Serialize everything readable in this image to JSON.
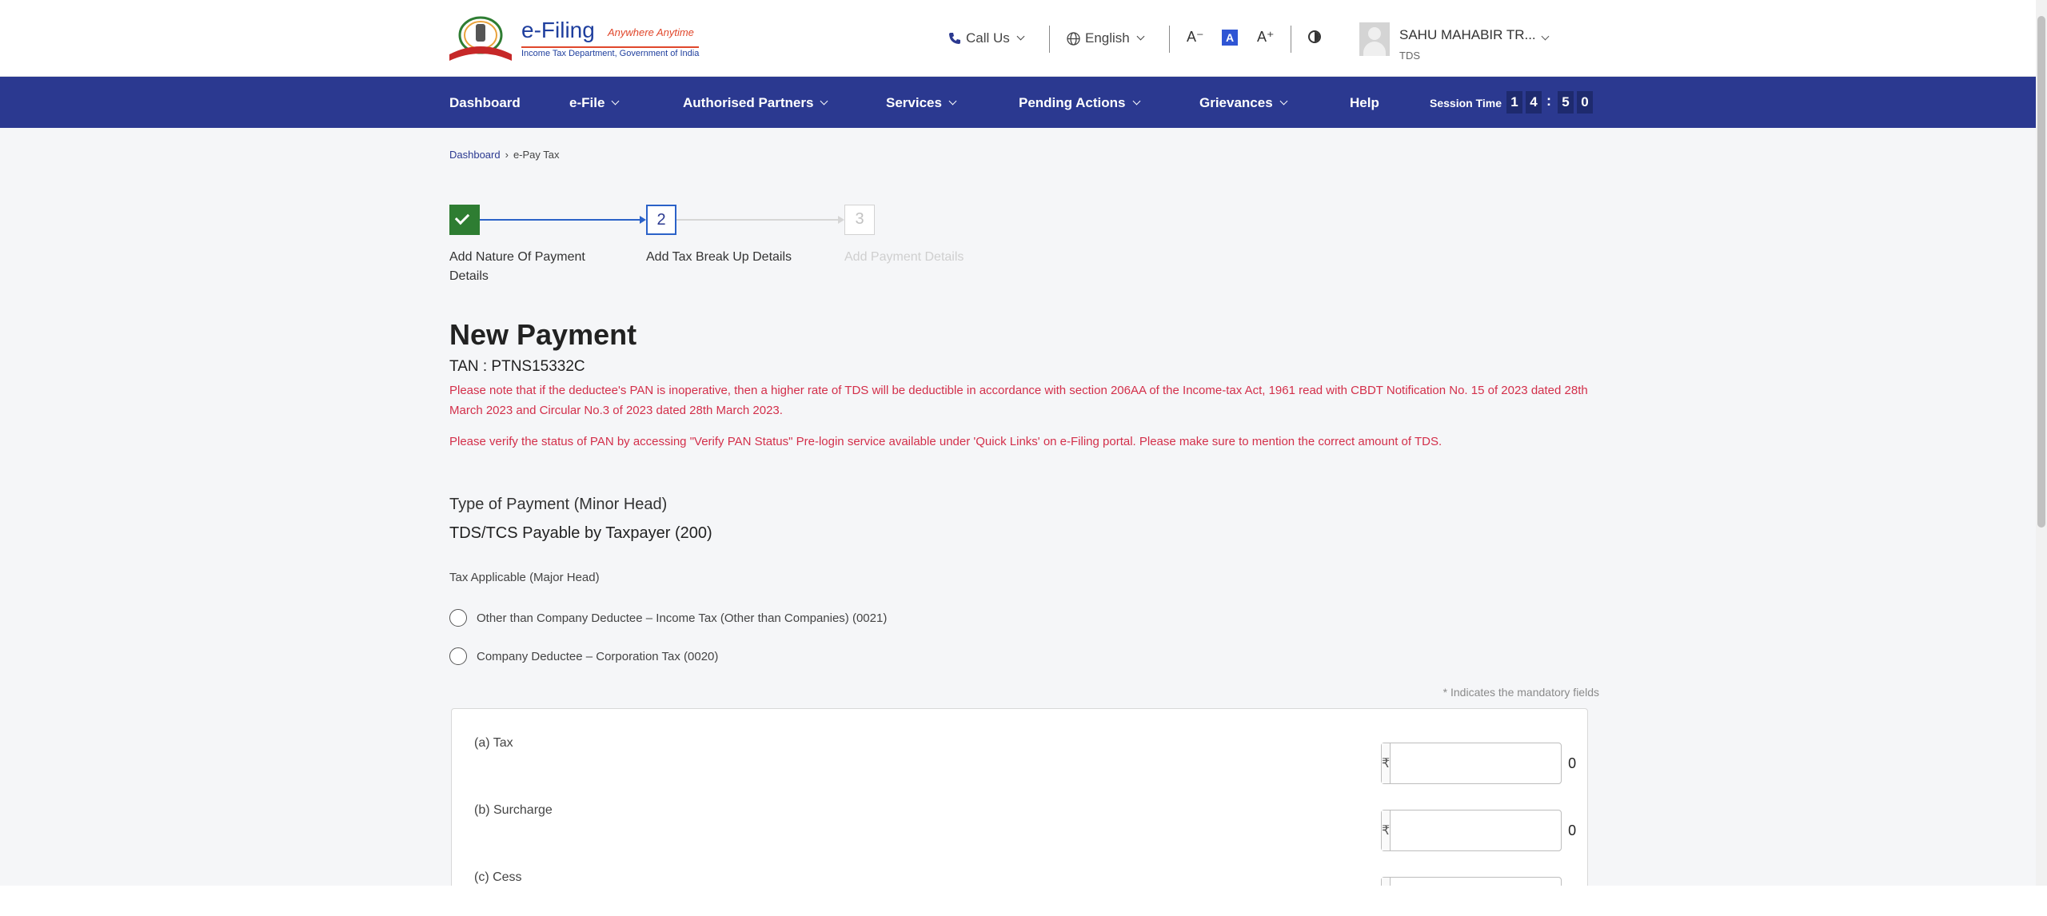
{
  "header": {
    "logo_title": "e-Filing",
    "logo_tagline": "Anywhere Anytime",
    "logo_subtitle": "Income Tax Department, Government of India",
    "call_us": "Call Us",
    "language": "English",
    "font_decrease": "A⁻",
    "font_normal": "A",
    "font_increase": "A⁺",
    "user_name": "SAHU MAHABIR TR...",
    "user_role": "TDS"
  },
  "nav": {
    "items": [
      "Dashboard",
      "e-File",
      "Authorised Partners",
      "Services",
      "Pending Actions",
      "Grievances",
      "Help"
    ],
    "session_label": "Session Time",
    "session_digits": [
      "1",
      "4",
      "5",
      "0"
    ],
    "session_colon": ":"
  },
  "breadcrumb": {
    "home": "Dashboard",
    "separator": "›",
    "current": "e-Pay Tax"
  },
  "stepper": {
    "steps": [
      {
        "number": "1",
        "label": "Add Nature Of Payment Details",
        "state": "done"
      },
      {
        "number": "2",
        "label": "Add Tax Break Up Details",
        "state": "active"
      },
      {
        "number": "3",
        "label": "Add Payment Details",
        "state": "pending"
      }
    ]
  },
  "main": {
    "title": "New Payment",
    "tan": "TAN : PTNS15332C",
    "warning_1": "Please note that if the deductee's PAN is inoperative, then a higher rate of TDS will be deductible in accordance with section 206AA of the Income-tax Act, 1961 read with CBDT Notification No. 15 of 2023 dated 28th March 2023 and Circular No.3 of 2023 dated 28th March 2023.",
    "warning_2": "Please verify the status of PAN by accessing \"Verify PAN Status\" Pre-login service available under 'Quick Links' on e-Filing portal. Please make sure to mention the correct amount of TDS.",
    "type_label": "Type of Payment (Minor Head)",
    "type_value": "TDS/TCS Payable by Taxpayer (200)",
    "tax_applicable_label": "Tax Applicable (Major Head)",
    "radio_options": [
      "Other than Company Deductee – Income Tax (Other than Companies) (0021)",
      "Company Deductee – Corporation Tax (0020)"
    ],
    "mandatory_note": "* Indicates the mandatory fields"
  },
  "breakup": {
    "currency_symbol": "₹",
    "fields": [
      {
        "label": "(a) Tax",
        "value": "0"
      },
      {
        "label": "(b) Surcharge",
        "value": "0"
      },
      {
        "label": "(c) Cess",
        "value": ""
      }
    ]
  },
  "colors": {
    "nav_bg": "#2b3990",
    "accent_blue": "#2b62c8",
    "success_green": "#2e7d32",
    "warning_red": "#d32f4a"
  }
}
